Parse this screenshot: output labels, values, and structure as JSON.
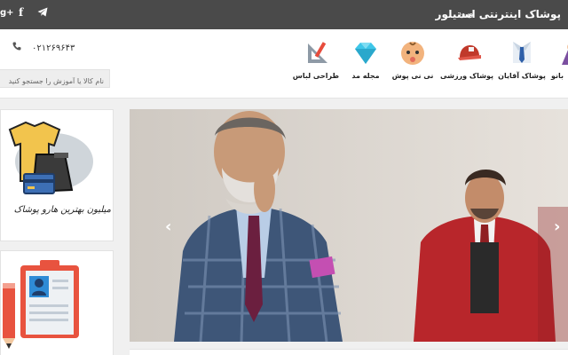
{
  "topbar": {
    "site_title": "پوشاک اینترنتی استیلور",
    "login": "ورود",
    "social": {
      "gplus": "g+",
      "facebook": "f",
      "telegram": "➤"
    }
  },
  "header": {
    "phone": "۰۲۱۲۶۹۶۴۳",
    "search": {
      "placeholder": "نام کالا یا آموزش را جستجو کنید"
    }
  },
  "nav": {
    "items": [
      {
        "label": "بانو",
        "icon": "woman-icon"
      },
      {
        "label": "پوشاک آقایان",
        "icon": "tie-icon"
      },
      {
        "label": "پوشاک ورزشی",
        "icon": "cap-icon"
      },
      {
        "label": "نی نی پوش",
        "icon": "baby-icon"
      },
      {
        "label": "مجله مد",
        "icon": "diamond-icon"
      },
      {
        "label": "طراحی لباس",
        "icon": "drafting-tools-icon"
      }
    ]
  },
  "promo": {
    "card1_caption": "میلیون بهترین هارو پوشاک",
    "card1_icon": "shirt-and-card-icon",
    "card2_icon": "clipboard-profile-icon"
  },
  "slider": {
    "prev": "‹",
    "next": "›"
  },
  "colors": {
    "topbar": "#4a4a4a",
    "accent_red": "#c0392b",
    "diamond": "#3ec6e8"
  }
}
